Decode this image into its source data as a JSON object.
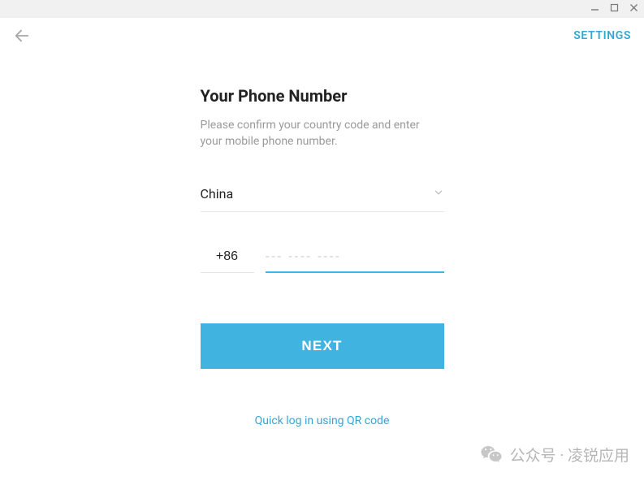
{
  "header": {
    "settings_label": "SETTINGS"
  },
  "form": {
    "title": "Your Phone Number",
    "subtitle": "Please confirm your country code and enter your mobile phone number.",
    "country_selected": "China",
    "code_value": "+86",
    "phone_placeholder": "--- ---- ----",
    "phone_value": "",
    "next_label": "NEXT",
    "qr_link_label": "Quick log in using QR code"
  },
  "watermark": {
    "text": "公众号 · 凌锐应用"
  }
}
